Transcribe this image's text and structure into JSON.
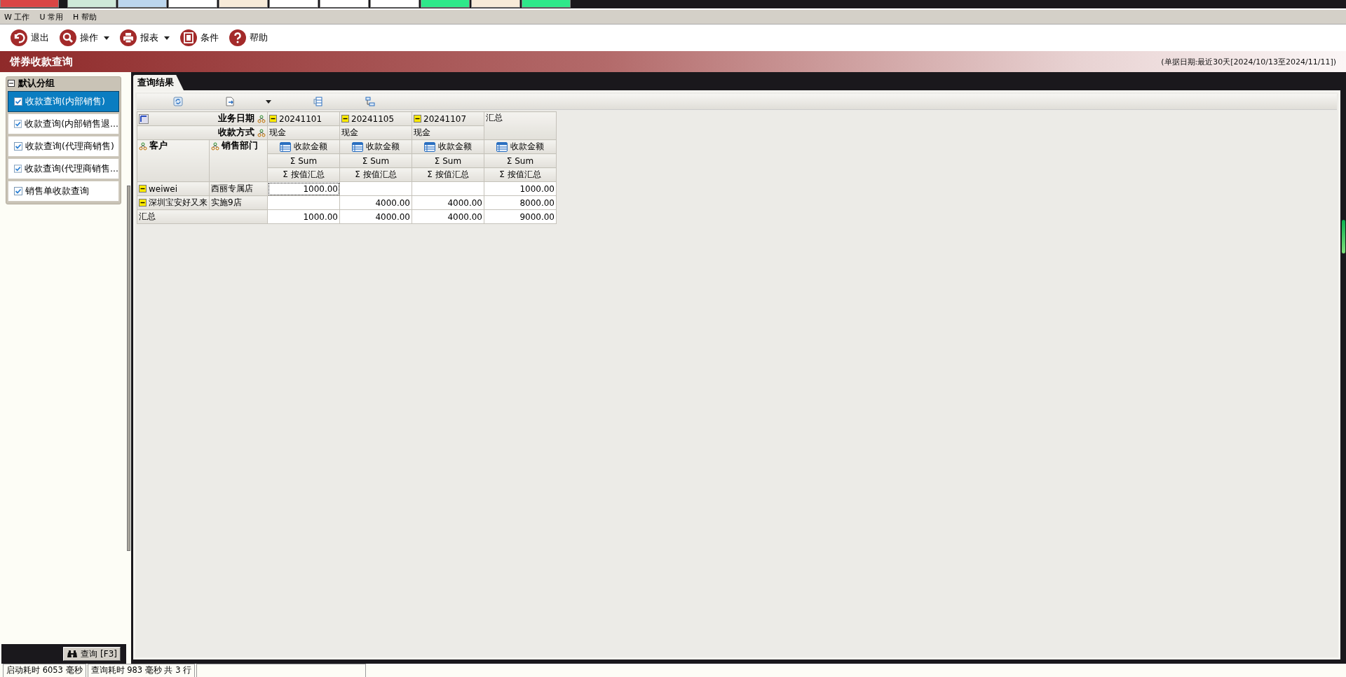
{
  "top_tabs": [
    {
      "color": "#d94545"
    },
    {
      "color": "#cfe8d8"
    },
    {
      "color": "#bcd6ee"
    },
    {
      "color": "#ffffff"
    },
    {
      "color": "#f7ead8"
    },
    {
      "color": "#ffffff"
    },
    {
      "color": "#ffffff"
    },
    {
      "color": "#ffffff"
    },
    {
      "color": "#2ee88a"
    },
    {
      "color": "#f7ead8"
    },
    {
      "color": "#2ee88a"
    }
  ],
  "menu": [
    "W 工作",
    "U 常用",
    "H 帮助"
  ],
  "toolbar": [
    {
      "label": "退出",
      "kind": "back",
      "dropdown": false
    },
    {
      "label": "操作",
      "kind": "search",
      "dropdown": true
    },
    {
      "label": "报表",
      "kind": "print",
      "dropdown": true
    },
    {
      "label": "条件",
      "kind": "card",
      "dropdown": false
    },
    {
      "label": "帮助",
      "kind": "help",
      "dropdown": false
    }
  ],
  "page_title": "饼券收款查询",
  "date_range": "(单据日期:最近30天[2024/10/13至2024/11/11])",
  "sidebar": {
    "group": "默认分组",
    "expanded": true,
    "items": [
      {
        "label": "收款查询(内部销售)",
        "checked": true,
        "selected": true
      },
      {
        "label": "收款查询(内部销售退...",
        "checked": true,
        "selected": false
      },
      {
        "label": "收款查询(代理商销售)",
        "checked": true,
        "selected": false
      },
      {
        "label": "收款查询(代理商销售...",
        "checked": true,
        "selected": false
      },
      {
        "label": "销售单收款查询",
        "checked": true,
        "selected": false
      }
    ],
    "query_button": "查询 [F3]"
  },
  "result_tab": "查询结果",
  "pivot": {
    "tools": [
      {
        "kind": "refresh",
        "dropdown": false
      },
      {
        "kind": "export",
        "dropdown": true
      },
      {
        "kind": "layout",
        "dropdown": false
      },
      {
        "kind": "tree",
        "dropdown": false
      }
    ],
    "column_fields": [
      "业务日期",
      "收款方式"
    ],
    "row_fields": [
      "客户",
      "销售部门"
    ],
    "columns": [
      {
        "date": "20241101",
        "method": "现金",
        "expanded": true
      },
      {
        "date": "20241105",
        "method": "现金",
        "expanded": true
      },
      {
        "date": "20241107",
        "method": "现金",
        "expanded": true
      }
    ],
    "grand_total": "汇总",
    "data_headers": [
      {
        "measure": "收款金额",
        "summary": "Σ  Sum",
        "aggregate": "Σ  按值汇总"
      },
      {
        "measure": "收款金额",
        "summary": "Σ  Sum",
        "aggregate": "Σ  按值汇总"
      },
      {
        "measure": "收款金额",
        "summary": "Σ  Sum",
        "aggregate": "Σ  按值汇总"
      },
      {
        "measure": "收款金额",
        "summary": "Σ  Sum",
        "aggregate": "Σ  按值汇总"
      }
    ],
    "rows": [
      {
        "customer": "weiwei",
        "dept": "西丽专属店",
        "expanded": true,
        "cells": [
          {
            "text": "1000.00",
            "focused": true
          },
          {
            "focused": false
          },
          {
            "focused": false
          },
          {
            "text": "1000.00",
            "focused": false
          }
        ]
      },
      {
        "customer": "深圳宝安好又来",
        "dept": "实施9店",
        "expanded": true,
        "cells": [
          {
            "focused": false
          },
          {
            "text": "4000.00",
            "focused": false
          },
          {
            "text": "4000.00",
            "focused": false
          },
          {
            "text": "8000.00",
            "focused": false
          }
        ]
      }
    ],
    "total_row": {
      "label": "汇总",
      "cells": [
        {
          "text": "1000.00",
          "focused": false
        },
        {
          "text": "4000.00",
          "focused": false
        },
        {
          "text": "4000.00",
          "focused": false
        },
        {
          "text": "9000.00",
          "focused": false
        }
      ]
    }
  },
  "status_bar": [
    "启动耗时 6053 毫秒",
    "查询耗时 983 毫秒  共 3 行"
  ]
}
